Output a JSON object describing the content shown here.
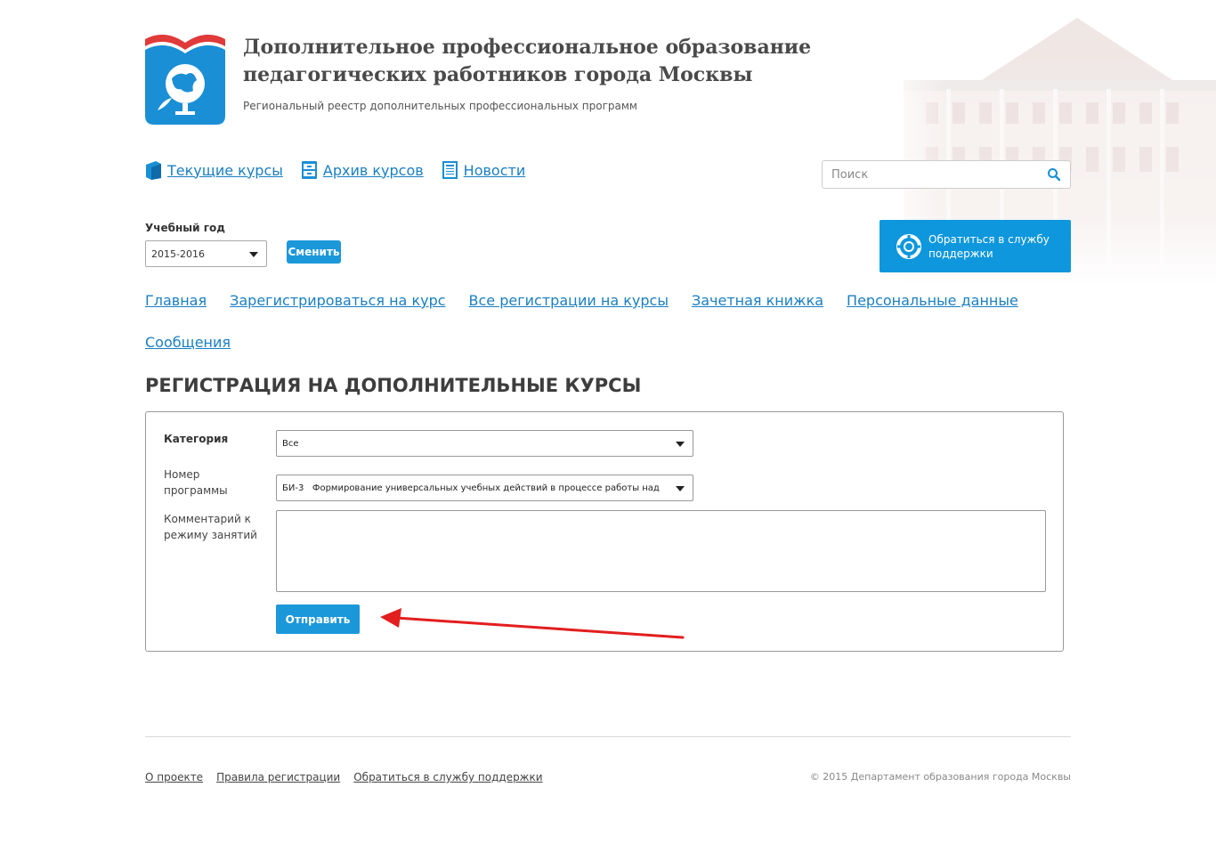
{
  "header": {
    "title": "Дополнительное профессиональное образование педагогических работников города Москвы",
    "subtitle": "Региональный реестр дополнительных профессиональных программ"
  },
  "topnav": [
    {
      "label": "Текущие курсы",
      "icon": "book-icon"
    },
    {
      "label": "Архив курсов",
      "icon": "archive-icon"
    },
    {
      "label": "Новости",
      "icon": "newspaper-icon"
    }
  ],
  "search": {
    "placeholder": "Поиск",
    "icon": "search-icon"
  },
  "year": {
    "label": "Учебный год",
    "value": "2015-2016",
    "change_label": "Сменить"
  },
  "support_button": {
    "label": "Обратиться в службу поддержки",
    "icon": "lifebuoy-icon"
  },
  "mainnav": {
    "row1": [
      "Главная",
      "Зарегистрироваться на курс",
      "Все регистрации на курсы",
      "Зачетная книжка",
      "Персональные данные"
    ],
    "row2": [
      "Сообщения"
    ]
  },
  "page_heading": "РЕГИСТРАЦИЯ НА ДОПОЛНИТЕЛЬНЫЕ КУРСЫ",
  "form": {
    "category_label": "Категория",
    "category_value": "Все",
    "program_label": "Номер программы",
    "program_value": "БИ-3   Формирование универсальных учебных действий в процессе работы над",
    "comment_label": "Комментарий к режиму занятий",
    "comment_value": "",
    "submit_label": "Отправить"
  },
  "footer": {
    "links": [
      "О проекте",
      "Правила регистрации",
      "Обратиться в службу поддержки"
    ],
    "copyright": "© 2015 Департамент образования города Москвы"
  },
  "colors": {
    "accent": "#1b98da",
    "link": "#1a7fc1",
    "arrow": "#e31e1e"
  }
}
